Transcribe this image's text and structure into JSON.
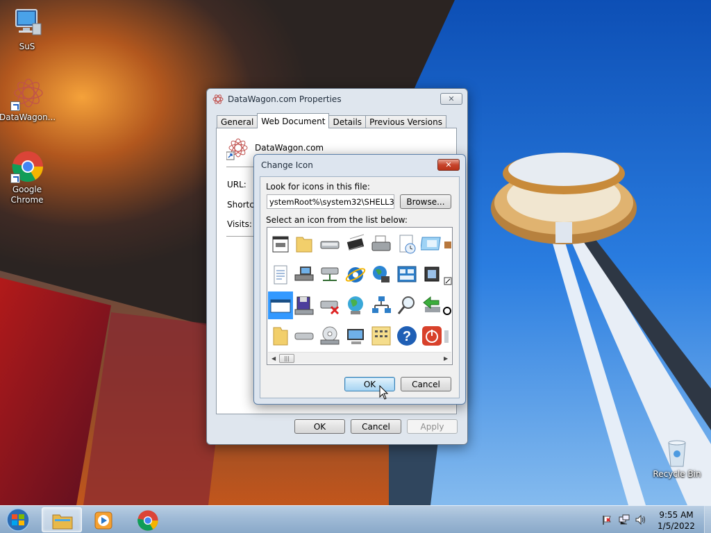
{
  "desktop": {
    "icons": [
      {
        "label": "SuS"
      },
      {
        "label": "DataWagon..."
      },
      {
        "label": "Google Chrome"
      },
      {
        "label": "Recycle Bin"
      }
    ]
  },
  "properties_window": {
    "title": "DataWagon.com Properties",
    "tabs": [
      "General",
      "Web Document",
      "Details",
      "Previous Versions"
    ],
    "active_tab": "Web Document",
    "item_name": "DataWagon.com",
    "fields": {
      "url_label": "URL:",
      "shortcut_label": "Shortcut",
      "visits_label": "Visits:"
    },
    "buttons": {
      "ok": "OK",
      "cancel": "Cancel",
      "apply": "Apply"
    }
  },
  "change_icon_dialog": {
    "title": "Change Icon",
    "file_label": "Look for icons in this file:",
    "file_value": "ystemRoot%\\system32\\SHELL32.dll",
    "browse": "Browse...",
    "list_label": "Select an icon from the list below:",
    "selected_index": "row 3, column 1",
    "buttons": {
      "ok": "OK",
      "cancel": "Cancel"
    }
  },
  "taskbar": {
    "pinned": [
      "Start",
      "Windows Explorer",
      "Windows Media Player",
      "Google Chrome"
    ],
    "active": "Windows Explorer",
    "tray": [
      "action-center-flag",
      "network",
      "volume"
    ],
    "time": "9:55 AM",
    "date": "1/5/2022"
  },
  "colors": {
    "taskbar": "#9fbad6",
    "selection": "#3399ff",
    "close_red": "#c7452c",
    "sky": "#1d6fd3"
  }
}
